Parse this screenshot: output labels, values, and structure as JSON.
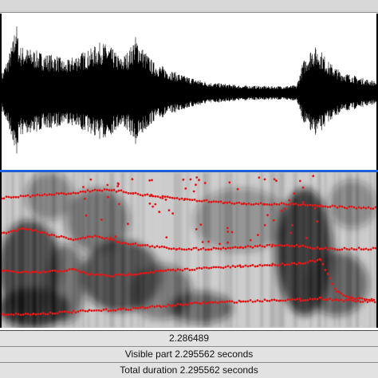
{
  "cursor_time": "2.286489",
  "visible_part": "Visible part 2.295562 seconds",
  "total_duration": "Total duration 2.295562 seconds",
  "colors": {
    "waveform": "#000000",
    "formant_dots": "#e01818",
    "selection_divider": "#1d5fd8",
    "bar_background": "#e2e2e2"
  }
}
